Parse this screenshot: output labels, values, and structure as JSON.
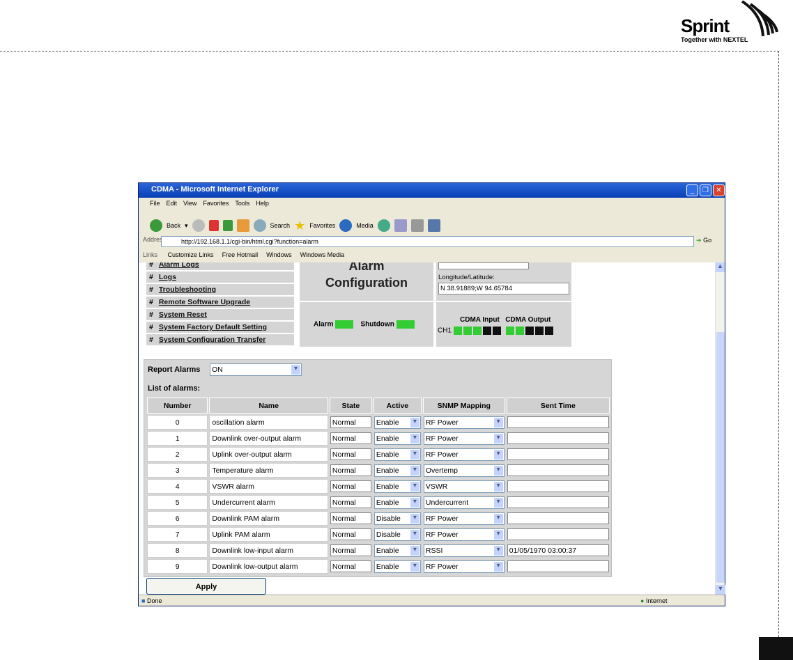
{
  "brand": {
    "name": "Sprint",
    "tagline": "Together with NEXTEL"
  },
  "window": {
    "title": "CDMA - Microsoft Internet Explorer"
  },
  "menu": [
    "File",
    "Edit",
    "View",
    "Favorites",
    "Tools",
    "Help"
  ],
  "toolbar": {
    "back": "Back",
    "search": "Search",
    "favorites": "Favorites",
    "media": "Media"
  },
  "address": {
    "label": "Address",
    "url": "http://192.168.1.1/cgi-bin/html.cgi?function=alarm",
    "go": "Go"
  },
  "links": {
    "label": "Links",
    "items": [
      "Customize Links",
      "Free Hotmail",
      "Windows",
      "Windows Media"
    ]
  },
  "nav": [
    {
      "bullet": "#",
      "label": "Alarm Logs"
    },
    {
      "bullet": "#",
      "label": "Logs"
    },
    {
      "bullet": "#",
      "label": "Troubleshooting"
    },
    {
      "bullet": "#",
      "label": "Remote Software Upgrade"
    },
    {
      "bullet": "#",
      "label": "System Reset"
    },
    {
      "bullet": "#",
      "label": "System Factory Default Setting"
    },
    {
      "bullet": "#",
      "label": "System Configuration Transfer"
    }
  ],
  "header": {
    "title_line1": "Alarm",
    "title_line2": "Configuration",
    "lonlat_label": "Longitude/Latitude:",
    "lonlat_value": "N 38.91889;W 94.65784",
    "alarm": "Alarm",
    "shutdown": "Shutdown",
    "cdma_input": "CDMA Input",
    "cdma_output": "CDMA Output",
    "channel": "CH1",
    "input_leds": [
      "green",
      "green",
      "green",
      "black",
      "black"
    ],
    "output_leds": [
      "green",
      "green",
      "black",
      "black",
      "black"
    ],
    "colors": {
      "green": "#33cc33",
      "black": "#111111"
    }
  },
  "form": {
    "report_label": "Report Alarms",
    "report_value": "ON",
    "list_label": "List of alarms:",
    "columns": [
      "Number",
      "Name",
      "State",
      "Active",
      "SNMP Mapping",
      "Sent Time"
    ],
    "rows": [
      {
        "number": "0",
        "name": "oscillation alarm",
        "state": "Normal",
        "active": "Enable",
        "snmp": "RF Power",
        "sent": ""
      },
      {
        "number": "1",
        "name": "Downlink over-output alarm",
        "state": "Normal",
        "active": "Enable",
        "snmp": "RF Power",
        "sent": ""
      },
      {
        "number": "2",
        "name": "Uplink over-output alarm",
        "state": "Normal",
        "active": "Enable",
        "snmp": "RF Power",
        "sent": ""
      },
      {
        "number": "3",
        "name": "Temperature alarm",
        "state": "Normal",
        "active": "Enable",
        "snmp": "Overtemp",
        "sent": ""
      },
      {
        "number": "4",
        "name": "VSWR alarm",
        "state": "Normal",
        "active": "Enable",
        "snmp": "VSWR",
        "sent": ""
      },
      {
        "number": "5",
        "name": "Undercurrent alarm",
        "state": "Normal",
        "active": "Enable",
        "snmp": "Undercurrent",
        "sent": ""
      },
      {
        "number": "6",
        "name": "Downlink PAM alarm",
        "state": "Normal",
        "active": "Disable",
        "snmp": "RF Power",
        "sent": ""
      },
      {
        "number": "7",
        "name": "Uplink PAM alarm",
        "state": "Normal",
        "active": "Disable",
        "snmp": "RF Power",
        "sent": ""
      },
      {
        "number": "8",
        "name": "Downlink low-input alarm",
        "state": "Normal",
        "active": "Enable",
        "snmp": "RSSI",
        "sent": "01/05/1970 03:00:37"
      },
      {
        "number": "9",
        "name": "Downlink low-output alarm",
        "state": "Normal",
        "active": "Enable",
        "snmp": "RF Power",
        "sent": ""
      }
    ],
    "apply": "Apply"
  },
  "status": {
    "text": "Done",
    "zone": "Internet"
  }
}
